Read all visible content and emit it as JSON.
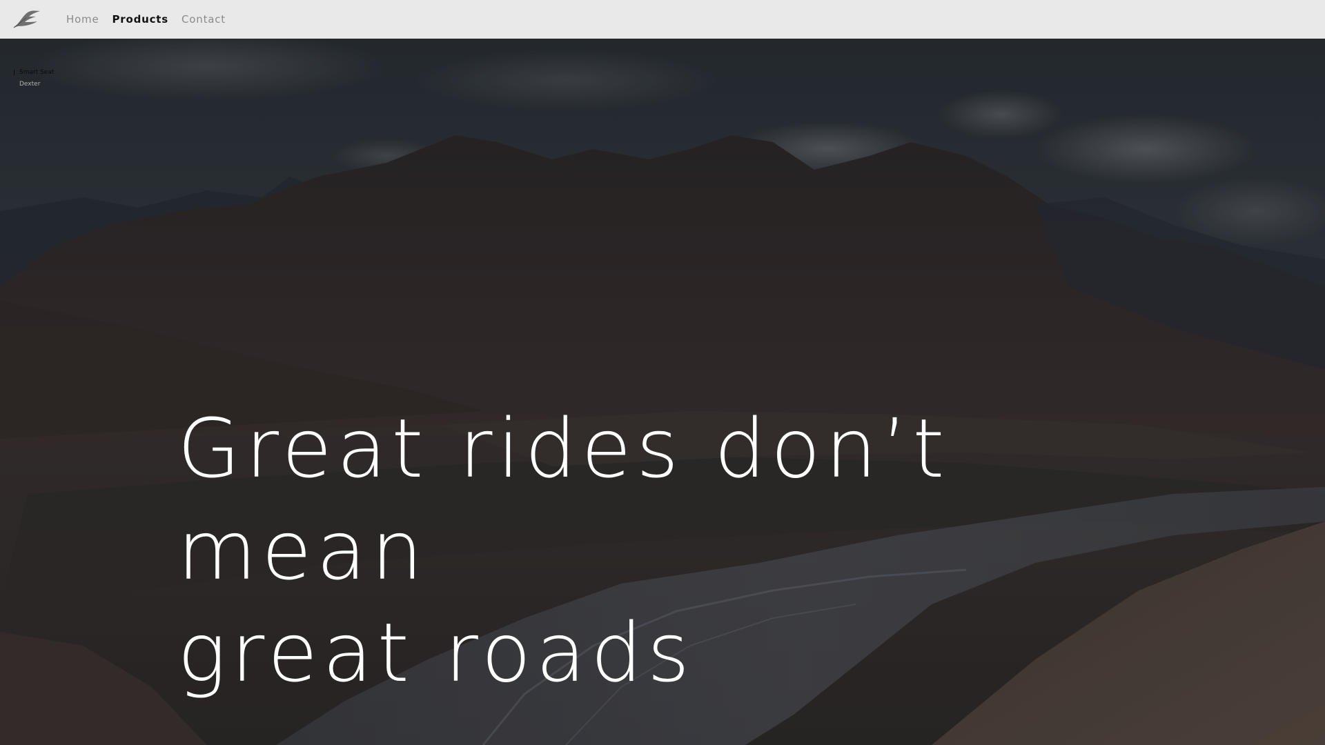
{
  "topbar": {
    "logo_icon": "feather-logo-icon",
    "nav": [
      {
        "label": "Home",
        "active": false
      },
      {
        "label": "Products",
        "active": true
      },
      {
        "label": "Contact",
        "active": false
      }
    ]
  },
  "sidenav": {
    "items": [
      {
        "label": "Smart Seat",
        "active": true
      },
      {
        "label": "Dexter",
        "active": false
      }
    ]
  },
  "hero": {
    "headline_line1": "Great rides don’t mean",
    "headline_line2": "great roads",
    "background": "mountain-valley-image"
  },
  "colors": {
    "topbar_bg": "#e9e9e9",
    "nav_active": "#111111",
    "nav_inactive": "#8a8a8a",
    "headline": "#ffffff"
  }
}
